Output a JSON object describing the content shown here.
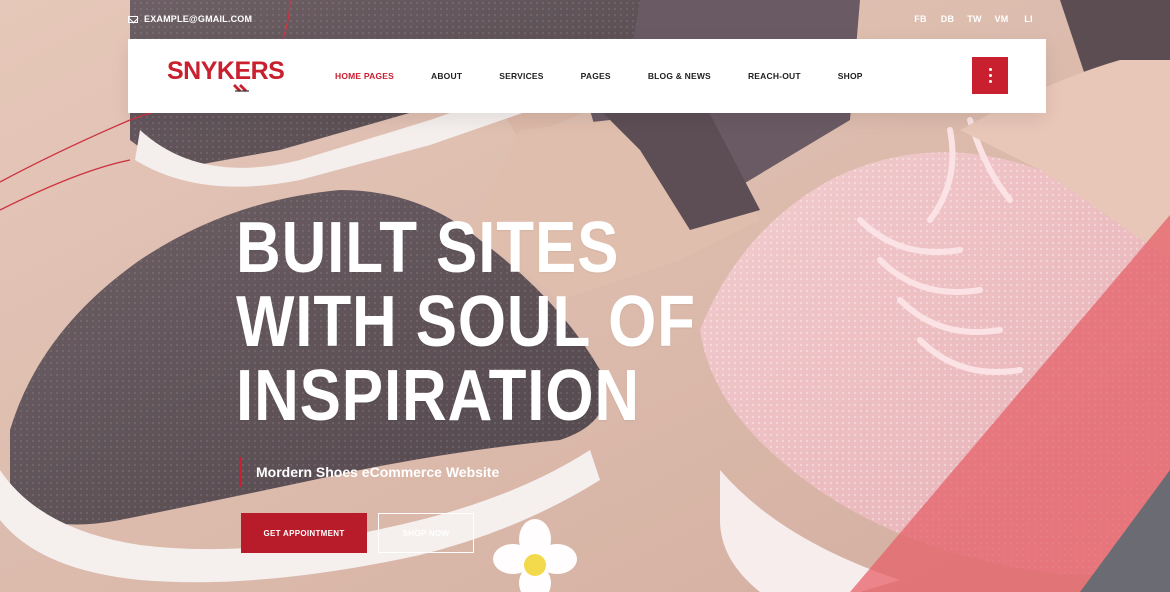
{
  "topbar": {
    "email": "EXAMPLE@GMAIL.COM",
    "social": [
      "FB",
      "DB",
      "TW",
      "VM",
      "LI"
    ]
  },
  "brand": {
    "logo_text": "SNYKERS",
    "accent": "#c8202f"
  },
  "nav": {
    "items": [
      {
        "label": "HOME PAGES",
        "active": true
      },
      {
        "label": "ABOUT",
        "active": false
      },
      {
        "label": "SERVICES",
        "active": false
      },
      {
        "label": "PAGES",
        "active": false
      },
      {
        "label": "BLOG & NEWS",
        "active": false
      },
      {
        "label": "REACH-OUT",
        "active": false
      },
      {
        "label": "SHOP",
        "active": false
      }
    ],
    "menu_icon": "vertical-dots-icon"
  },
  "hero": {
    "headline": [
      "BUILT SITES",
      "WITH SOUL OF",
      "INSPIRATION"
    ],
    "subtitle": "Mordern Shoes eCommerce Website",
    "primary_button": "GET APPOINTMENT",
    "secondary_button": "SHOP NOW"
  }
}
